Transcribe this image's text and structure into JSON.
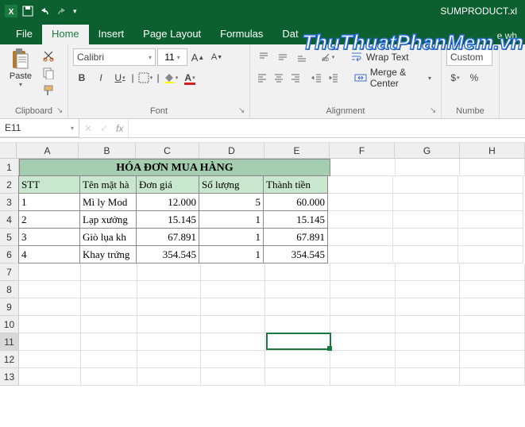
{
  "titlebar": {
    "filename": "SUMPRODUCT.xl"
  },
  "tabs": {
    "file": "File",
    "home": "Home",
    "insert": "Insert",
    "pagelayout": "Page Layout",
    "formulas": "Formulas",
    "data": "Dat",
    "tell": "e wh"
  },
  "ribbon": {
    "clipboard": {
      "label": "Clipboard",
      "paste": "Paste"
    },
    "font": {
      "label": "Font",
      "name": "Calibri",
      "size": "11",
      "grow_icon": "A▲",
      "shrink_icon": "A▼",
      "bold": "B",
      "italic": "I",
      "underline": "U"
    },
    "alignment": {
      "label": "Alignment",
      "wrap": "Wrap Text",
      "merge": "Merge & Center"
    },
    "number": {
      "label": "Numbe",
      "format": "Custom",
      "currency": "$",
      "percent": "%",
      "comma": ","
    }
  },
  "namebox": "E11",
  "fbar": {
    "cancel": "✕",
    "enter": "✓",
    "fx": "fx"
  },
  "columns": [
    "A",
    "B",
    "C",
    "D",
    "E",
    "F",
    "G",
    "H"
  ],
  "rows": [
    "1",
    "2",
    "3",
    "4",
    "5",
    "6",
    "7",
    "8",
    "9",
    "10",
    "11",
    "12",
    "13"
  ],
  "sheet": {
    "title": "HÓA ĐƠN MUA HÀNG",
    "headers": {
      "a": "STT",
      "b": "Tên mặt hà",
      "c": "Đơn giá",
      "d": "Số lượng",
      "e": "Thành tiền"
    },
    "r3": {
      "a": "1",
      "b": "Mì ly Mod",
      "c": "12.000",
      "d": "5",
      "e": "60.000"
    },
    "r4": {
      "a": "2",
      "b": "Lạp xưởng",
      "c": "15.145",
      "d": "1",
      "e": "15.145"
    },
    "r5": {
      "a": "3",
      "b": "Giò lụa kh",
      "c": "67.891",
      "d": "1",
      "e": "67.891"
    },
    "r6": {
      "a": "4",
      "b": "Khay trứng",
      "c": "354.545",
      "d": "1",
      "e": "354.545"
    }
  },
  "watermark": "ThuThuatPhanMem.vn"
}
